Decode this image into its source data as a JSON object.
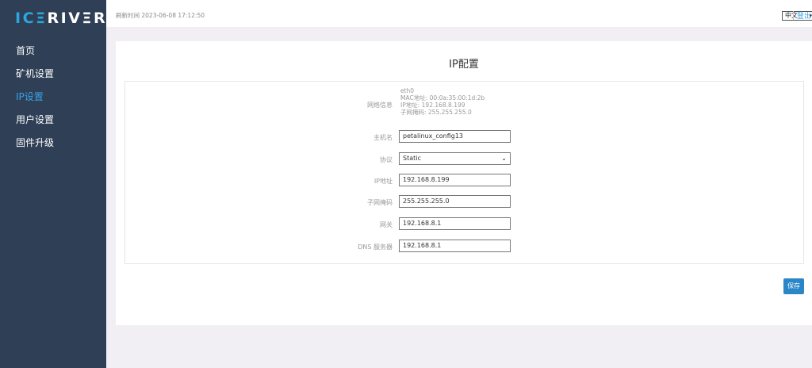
{
  "brand": {
    "part1": "IC",
    "part2": "≡",
    "part3": "RIV",
    "part4": "≡",
    "part5": "R"
  },
  "sidebar": {
    "items": [
      {
        "label": "首页"
      },
      {
        "label": "矿机设置"
      },
      {
        "label": "IP设置"
      },
      {
        "label": "用户设置"
      },
      {
        "label": "固件升级"
      }
    ],
    "active_index": 2
  },
  "topbar": {
    "refresh_label": "刷新时间",
    "refresh_time": "2023-06-08 17:12:50",
    "language": "中文",
    "logout": "登出"
  },
  "page": {
    "title": "IP配置"
  },
  "network_info": {
    "label": "网络信息",
    "interface": "eth0",
    "mac": "MAC地址: 00:0a:35:00:1d:2b",
    "ip": "IP地址: 192.168.8.199",
    "mask": "子网掩码: 255.255.255.0"
  },
  "form": {
    "hostname": {
      "label": "主机名",
      "value": "petalinux_config13"
    },
    "protocol": {
      "label": "协议",
      "value": "Static"
    },
    "ip": {
      "label": "IP地址",
      "value": "192.168.8.199"
    },
    "netmask": {
      "label": "子网掩码",
      "value": "255.255.255.0"
    },
    "gateway": {
      "label": "网关",
      "value": "192.168.8.1"
    },
    "dns": {
      "label": "DNS 服务器",
      "value": "192.168.8.1"
    }
  },
  "actions": {
    "save": "保存"
  },
  "colors": {
    "sidebar_bg": "#2f3f55",
    "accent": "#3aa2e6",
    "button": "#2b86c8",
    "page_bg": "#f1eef4"
  }
}
